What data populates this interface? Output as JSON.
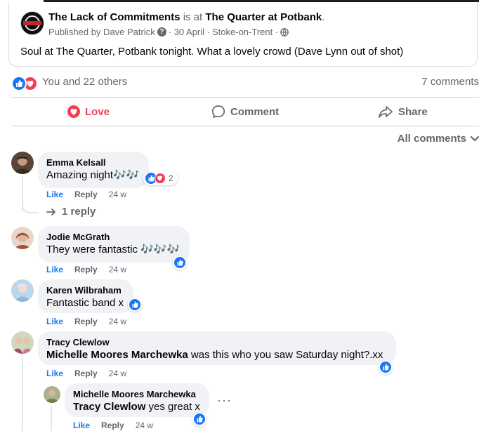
{
  "post": {
    "page_name": "The Lack of Commitments",
    "is_at": "is at",
    "location": "The Quarter at Potbank",
    "period": ".",
    "published_by": "Published by Dave Patrick",
    "date": "· 30 April ·",
    "place": "Stoke-on-Trent ·",
    "text": "Soul at The Quarter, Potbank tonight. What a lovely crowd (Dave Lynn out of shot)"
  },
  "reactions": {
    "summary": "You and 22 others",
    "comments_count": "7 comments"
  },
  "actions": {
    "love": "Love",
    "comment": "Comment",
    "share": "Share"
  },
  "filter": {
    "label": "All comments"
  },
  "comments": [
    {
      "name": "Emma Kelsall",
      "text": "Amazing night🎶🎶",
      "like": "Like",
      "reply": "Reply",
      "time": "24 w",
      "reaction_count": "2",
      "replies_label": "1 reply"
    },
    {
      "name": "Jodie McGrath",
      "text": "They were fantastic 🎶🎶🎶",
      "like": "Like",
      "reply": "Reply",
      "time": "24 w"
    },
    {
      "name": "Karen Wilbraham",
      "text": "Fantastic band x",
      "like": "Like",
      "reply": "Reply",
      "time": "24 w"
    },
    {
      "name": "Tracy Clewlow",
      "mention": "Michelle Moores Marchewka",
      "text": "was this who you saw Saturday night?.xx",
      "like": "Like",
      "reply": "Reply",
      "time": "24 w"
    }
  ],
  "reply": {
    "name": "Michelle Moores Marchewka",
    "mention": "Tracy Clewlow",
    "text": "yes great x",
    "like": "Like",
    "reply": "Reply",
    "time": "24 w",
    "more": "···"
  },
  "colors": {
    "accent": "#1877f2",
    "love": "#f33e58",
    "muted": "#65676b",
    "bubble": "#f0f2f5"
  }
}
